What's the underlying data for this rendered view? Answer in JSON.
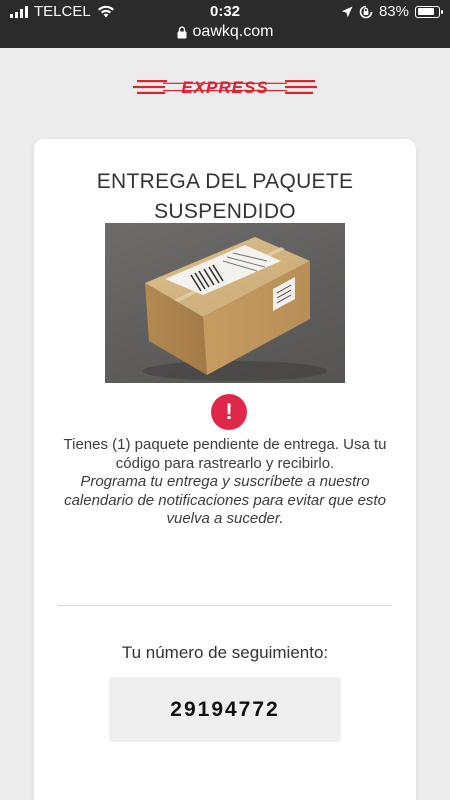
{
  "status_bar": {
    "carrier": "TELCEL",
    "time": "0:32",
    "battery_percent": "83%",
    "battery_level": 0.83,
    "url": "oawkq.com",
    "icons": [
      "signal-icon",
      "wifi-icon",
      "lock-icon",
      "location-arrow-icon",
      "orientation-lock-icon",
      "battery-icon"
    ]
  },
  "brand": {
    "logo_text": "EXPRESS",
    "color": "#d9232e"
  },
  "card": {
    "title": "ENTREGA DEL PAQUETE SUSPENDIDO",
    "alert_symbol": "!",
    "message": "Tienes (1) paquete pendiente de entrega. Usa tu código para rastrearlo y recibirlo.",
    "message_italic": "Programa tu entrega y suscríbete a nuestro calendario de notificaciones para evitar que esto vuelva a suceder.",
    "tracking_label": "Tu número de seguimiento:",
    "tracking_number": "29194772"
  },
  "colors": {
    "alert": "#e0274a",
    "status_bar_bg": "#2b2b2b",
    "page_bg": "#ececec"
  }
}
